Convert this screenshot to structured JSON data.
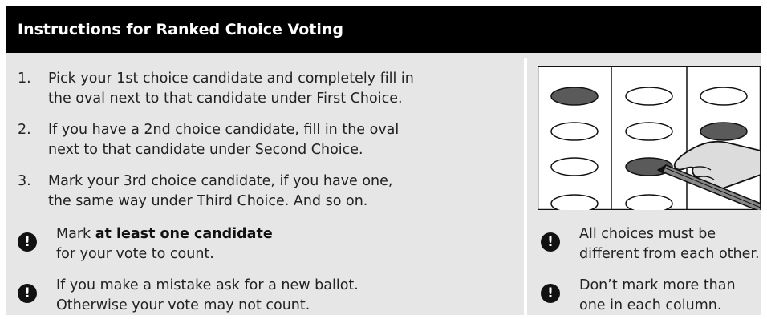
{
  "header": {
    "title": "Instructions for Ranked Choice Voting"
  },
  "steps": [
    {
      "number": "1.",
      "line1": "Pick your 1st choice candidate and completely fill in",
      "line2": "the oval next to that candidate under First Choice."
    },
    {
      "number": "2.",
      "line1": "If you have a 2nd choice candidate, fill in the oval",
      "line2": "next to that candidate under Second Choice."
    },
    {
      "number": "3.",
      "line1": "Mark your 3rd choice candidate, if you have one,",
      "line2": "the same way under Third Choice. And so on."
    }
  ],
  "warnings_left": [
    {
      "pre": "Mark ",
      "bold": "at least one candidate",
      "line2": "for your vote to count."
    },
    {
      "line1": "If you make a mistake ask for a new ballot.",
      "line2": "Otherwise your vote may not count."
    }
  ],
  "warnings_right": [
    {
      "line1": "All choices must be",
      "line2": "different from each other."
    },
    {
      "line1": "Don’t mark more than",
      "line2": "one in each column."
    }
  ],
  "icons": {
    "warning": "exclamation-icon",
    "glyph": "!"
  },
  "colors": {
    "header_bg": "#000000",
    "panel_bg": "#e6e6e6",
    "filled_oval": "#5a5a5a"
  }
}
